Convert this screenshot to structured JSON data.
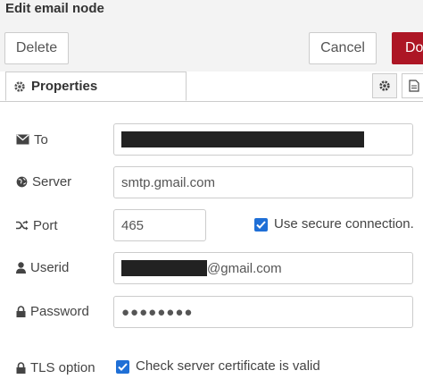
{
  "header": {
    "title": "Edit email node"
  },
  "toolbar": {
    "delete_label": "Delete",
    "cancel_label": "Cancel",
    "done_label": "Do"
  },
  "tabs": {
    "properties_label": "Properties",
    "properties_icon": "gear-icon"
  },
  "form": {
    "to": {
      "label": "To",
      "icon": "envelope-icon",
      "value": ""
    },
    "server": {
      "label": "Server",
      "icon": "globe-icon",
      "value": "smtp.gmail.com"
    },
    "port": {
      "label": "Port",
      "icon": "shuffle-icon",
      "value": "465",
      "secure_label": "Use secure connection.",
      "secure_checked": true
    },
    "userid": {
      "label": "Userid",
      "icon": "user-icon",
      "value_suffix": "@gmail.com"
    },
    "password": {
      "label": "Password",
      "icon": "lock-icon",
      "value": "●●●●●●●●"
    },
    "tls": {
      "label": "TLS option",
      "icon": "lock-icon",
      "check_label": "Check server certificate is valid",
      "checked": true
    }
  },
  "colors": {
    "done_button": "#ad1625",
    "checkbox": "#1f6fd6"
  }
}
